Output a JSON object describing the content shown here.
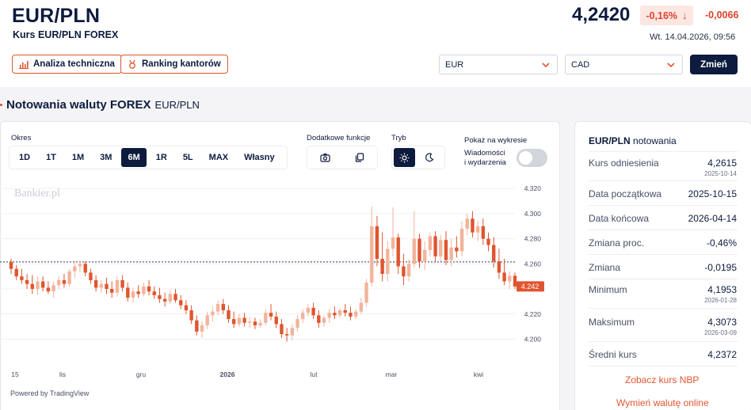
{
  "header": {
    "pair_title": "EUR/PLN",
    "pair_subtitle": "Kurs EUR/PLN FOREX",
    "rate": "4,2420",
    "change_pct": "-0,16%",
    "change_abs": "-0,0066",
    "timestamp": "Wt. 14.04.2026, 09:56",
    "btn_analysis": "Analiza techniczna",
    "btn_ranking": "Ranking kantorów",
    "select_from": "EUR",
    "select_to": "CAD",
    "btn_change": "Zmień"
  },
  "section": {
    "title": "Notowania waluty FOREX",
    "pair": "EUR/PLN"
  },
  "controls": {
    "period_label": "Okres",
    "ranges": [
      "1D",
      "1T",
      "1M",
      "3M",
      "6M",
      "1R",
      "5L",
      "MAX",
      "Własny"
    ],
    "active_range": "6M",
    "functions_label": "Dodatkowe funkcje",
    "mode_label": "Tryb",
    "show_label": "Pokaż na wykresie",
    "news_line1": "Wiadomości",
    "news_line2": "i wydarzenia"
  },
  "chart_data": {
    "type": "candlestick",
    "watermark": "Bankier.pl",
    "x_tick_labels": [
      "15",
      "lis",
      "gru",
      "2026",
      "lut",
      "mar",
      "kwi"
    ],
    "y_tick_labels": [
      "4.320",
      "4.300",
      "4.280",
      "4.260",
      "4.240",
      "4.220",
      "4.200"
    ],
    "ylim": [
      4.194,
      4.322
    ],
    "reference_value": 4.2615,
    "last_value": 4.242,
    "last_label": "4.242",
    "up_color": "#f2b49c",
    "down_color": "#e0552f",
    "candles": [
      {
        "o": 4.2615,
        "h": 4.264,
        "l": 4.252,
        "c": 4.256
      },
      {
        "o": 4.256,
        "h": 4.259,
        "l": 4.247,
        "c": 4.25
      },
      {
        "o": 4.25,
        "h": 4.256,
        "l": 4.244,
        "c": 4.247
      },
      {
        "o": 4.247,
        "h": 4.252,
        "l": 4.24,
        "c": 4.244
      },
      {
        "o": 4.244,
        "h": 4.251,
        "l": 4.236,
        "c": 4.24
      },
      {
        "o": 4.24,
        "h": 4.25,
        "l": 4.235,
        "c": 4.246
      },
      {
        "o": 4.246,
        "h": 4.25,
        "l": 4.238,
        "c": 4.241
      },
      {
        "o": 4.241,
        "h": 4.246,
        "l": 4.236,
        "c": 4.238
      },
      {
        "o": 4.238,
        "h": 4.246,
        "l": 4.233,
        "c": 4.243
      },
      {
        "o": 4.243,
        "h": 4.25,
        "l": 4.24,
        "c": 4.247
      },
      {
        "o": 4.247,
        "h": 4.252,
        "l": 4.241,
        "c": 4.244
      },
      {
        "o": 4.244,
        "h": 4.256,
        "l": 4.242,
        "c": 4.254
      },
      {
        "o": 4.254,
        "h": 4.262,
        "l": 4.249,
        "c": 4.258
      },
      {
        "o": 4.258,
        "h": 4.263,
        "l": 4.253,
        "c": 4.26
      },
      {
        "o": 4.26,
        "h": 4.262,
        "l": 4.25,
        "c": 4.253
      },
      {
        "o": 4.253,
        "h": 4.256,
        "l": 4.244,
        "c": 4.247
      },
      {
        "o": 4.247,
        "h": 4.251,
        "l": 4.238,
        "c": 4.241
      },
      {
        "o": 4.241,
        "h": 4.247,
        "l": 4.237,
        "c": 4.244
      },
      {
        "o": 4.244,
        "h": 4.249,
        "l": 4.236,
        "c": 4.24
      },
      {
        "o": 4.24,
        "h": 4.246,
        "l": 4.233,
        "c": 4.237
      },
      {
        "o": 4.237,
        "h": 4.25,
        "l": 4.234,
        "c": 4.247
      },
      {
        "o": 4.247,
        "h": 4.251,
        "l": 4.238,
        "c": 4.241
      },
      {
        "o": 4.241,
        "h": 4.245,
        "l": 4.23,
        "c": 4.233
      },
      {
        "o": 4.233,
        "h": 4.241,
        "l": 4.229,
        "c": 4.238
      },
      {
        "o": 4.238,
        "h": 4.243,
        "l": 4.233,
        "c": 4.236
      },
      {
        "o": 4.236,
        "h": 4.245,
        "l": 4.234,
        "c": 4.242
      },
      {
        "o": 4.242,
        "h": 4.247,
        "l": 4.235,
        "c": 4.238
      },
      {
        "o": 4.238,
        "h": 4.242,
        "l": 4.232,
        "c": 4.235
      },
      {
        "o": 4.235,
        "h": 4.241,
        "l": 4.229,
        "c": 4.232
      },
      {
        "o": 4.232,
        "h": 4.237,
        "l": 4.226,
        "c": 4.23
      },
      {
        "o": 4.23,
        "h": 4.239,
        "l": 4.228,
        "c": 4.236
      },
      {
        "o": 4.236,
        "h": 4.24,
        "l": 4.229,
        "c": 4.231
      },
      {
        "o": 4.231,
        "h": 4.235,
        "l": 4.224,
        "c": 4.227
      },
      {
        "o": 4.227,
        "h": 4.231,
        "l": 4.22,
        "c": 4.223
      },
      {
        "o": 4.223,
        "h": 4.227,
        "l": 4.212,
        "c": 4.215
      },
      {
        "o": 4.215,
        "h": 4.219,
        "l": 4.203,
        "c": 4.206
      },
      {
        "o": 4.206,
        "h": 4.214,
        "l": 4.201,
        "c": 4.211
      },
      {
        "o": 4.211,
        "h": 4.222,
        "l": 4.208,
        "c": 4.219
      },
      {
        "o": 4.219,
        "h": 4.226,
        "l": 4.214,
        "c": 4.222
      },
      {
        "o": 4.222,
        "h": 4.231,
        "l": 4.219,
        "c": 4.228
      },
      {
        "o": 4.228,
        "h": 4.232,
        "l": 4.22,
        "c": 4.223
      },
      {
        "o": 4.223,
        "h": 4.227,
        "l": 4.213,
        "c": 4.216
      },
      {
        "o": 4.216,
        "h": 4.222,
        "l": 4.209,
        "c": 4.212
      },
      {
        "o": 4.212,
        "h": 4.22,
        "l": 4.21,
        "c": 4.217
      },
      {
        "o": 4.217,
        "h": 4.221,
        "l": 4.21,
        "c": 4.213
      },
      {
        "o": 4.213,
        "h": 4.218,
        "l": 4.209,
        "c": 4.214
      },
      {
        "o": 4.214,
        "h": 4.217,
        "l": 4.208,
        "c": 4.211
      },
      {
        "o": 4.211,
        "h": 4.216,
        "l": 4.209,
        "c": 4.213
      },
      {
        "o": 4.213,
        "h": 4.224,
        "l": 4.211,
        "c": 4.221
      },
      {
        "o": 4.221,
        "h": 4.228,
        "l": 4.215,
        "c": 4.218
      },
      {
        "o": 4.218,
        "h": 4.222,
        "l": 4.209,
        "c": 4.212
      },
      {
        "o": 4.212,
        "h": 4.216,
        "l": 4.201,
        "c": 4.204
      },
      {
        "o": 4.204,
        "h": 4.209,
        "l": 4.198,
        "c": 4.203
      },
      {
        "o": 4.203,
        "h": 4.212,
        "l": 4.199,
        "c": 4.209
      },
      {
        "o": 4.209,
        "h": 4.219,
        "l": 4.206,
        "c": 4.216
      },
      {
        "o": 4.216,
        "h": 4.224,
        "l": 4.213,
        "c": 4.221
      },
      {
        "o": 4.221,
        "h": 4.228,
        "l": 4.218,
        "c": 4.225
      },
      {
        "o": 4.225,
        "h": 4.229,
        "l": 4.216,
        "c": 4.219
      },
      {
        "o": 4.219,
        "h": 4.223,
        "l": 4.209,
        "c": 4.213
      },
      {
        "o": 4.213,
        "h": 4.219,
        "l": 4.21,
        "c": 4.217
      },
      {
        "o": 4.217,
        "h": 4.224,
        "l": 4.213,
        "c": 4.221
      },
      {
        "o": 4.221,
        "h": 4.226,
        "l": 4.216,
        "c": 4.219
      },
      {
        "o": 4.219,
        "h": 4.225,
        "l": 4.217,
        "c": 4.223
      },
      {
        "o": 4.223,
        "h": 4.228,
        "l": 4.218,
        "c": 4.221
      },
      {
        "o": 4.221,
        "h": 4.226,
        "l": 4.215,
        "c": 4.218
      },
      {
        "o": 4.218,
        "h": 4.224,
        "l": 4.216,
        "c": 4.222
      },
      {
        "o": 4.222,
        "h": 4.233,
        "l": 4.22,
        "c": 4.229
      },
      {
        "o": 4.229,
        "h": 4.248,
        "l": 4.226,
        "c": 4.245
      },
      {
        "o": 4.245,
        "h": 4.306,
        "l": 4.242,
        "c": 4.29
      },
      {
        "o": 4.29,
        "h": 4.298,
        "l": 4.258,
        "c": 4.264
      },
      {
        "o": 4.264,
        "h": 4.285,
        "l": 4.246,
        "c": 4.252
      },
      {
        "o": 4.252,
        "h": 4.278,
        "l": 4.246,
        "c": 4.272
      },
      {
        "o": 4.272,
        "h": 4.305,
        "l": 4.266,
        "c": 4.281
      },
      {
        "o": 4.281,
        "h": 4.284,
        "l": 4.252,
        "c": 4.258
      },
      {
        "o": 4.258,
        "h": 4.268,
        "l": 4.243,
        "c": 4.25
      },
      {
        "o": 4.25,
        "h": 4.264,
        "l": 4.246,
        "c": 4.26
      },
      {
        "o": 4.26,
        "h": 4.302,
        "l": 4.257,
        "c": 4.28
      },
      {
        "o": 4.28,
        "h": 4.284,
        "l": 4.257,
        "c": 4.262
      },
      {
        "o": 4.262,
        "h": 4.278,
        "l": 4.255,
        "c": 4.271
      },
      {
        "o": 4.271,
        "h": 4.285,
        "l": 4.266,
        "c": 4.282
      },
      {
        "o": 4.282,
        "h": 4.286,
        "l": 4.262,
        "c": 4.266
      },
      {
        "o": 4.266,
        "h": 4.283,
        "l": 4.262,
        "c": 4.279
      },
      {
        "o": 4.279,
        "h": 4.286,
        "l": 4.259,
        "c": 4.263
      },
      {
        "o": 4.263,
        "h": 4.28,
        "l": 4.258,
        "c": 4.273
      },
      {
        "o": 4.273,
        "h": 4.282,
        "l": 4.265,
        "c": 4.27
      },
      {
        "o": 4.27,
        "h": 4.294,
        "l": 4.266,
        "c": 4.288
      },
      {
        "o": 4.288,
        "h": 4.3,
        "l": 4.283,
        "c": 4.296
      },
      {
        "o": 4.296,
        "h": 4.302,
        "l": 4.281,
        "c": 4.285
      },
      {
        "o": 4.285,
        "h": 4.294,
        "l": 4.278,
        "c": 4.29
      },
      {
        "o": 4.29,
        "h": 4.296,
        "l": 4.275,
        "c": 4.28
      },
      {
        "o": 4.28,
        "h": 4.285,
        "l": 4.27,
        "c": 4.275
      },
      {
        "o": 4.275,
        "h": 4.281,
        "l": 4.257,
        "c": 4.262
      },
      {
        "o": 4.262,
        "h": 4.272,
        "l": 4.248,
        "c": 4.253
      },
      {
        "o": 4.253,
        "h": 4.264,
        "l": 4.243,
        "c": 4.246
      },
      {
        "o": 4.246,
        "h": 4.254,
        "l": 4.24,
        "c": 4.2505
      },
      {
        "o": 4.2505,
        "h": 4.253,
        "l": 4.24,
        "c": 4.242
      }
    ]
  },
  "powered_by": "Powered by TradingView",
  "sidebar": {
    "title_pair": "EUR/PLN",
    "title_suffix": "notowania",
    "rows": [
      {
        "label": "Kurs odniesienia",
        "value": "4,2615",
        "date": "2025-10-14"
      },
      {
        "label": "Data początkowa",
        "value": "2025-10-15",
        "date": ""
      },
      {
        "label": "Data końcowa",
        "value": "2026-04-14",
        "date": ""
      },
      {
        "label": "Zmiana proc.",
        "value": "-0,46%",
        "date": ""
      },
      {
        "label": "Zmiana",
        "value": "-0,0195",
        "date": ""
      },
      {
        "label": "Minimum",
        "value": "4,1953",
        "date": "2026-01-28"
      },
      {
        "label": "Maksimum",
        "value": "4,3073",
        "date": "2026-03-09"
      },
      {
        "label": "Średni kurs",
        "value": "4,2372",
        "date": ""
      }
    ],
    "link_nbp": "Zobacz kurs NBP",
    "link_exchange": "Wymień walutę online"
  },
  "colors": {
    "accent": "#e0552f",
    "navy": "#0d1b3e",
    "negative": "#e0402a"
  }
}
